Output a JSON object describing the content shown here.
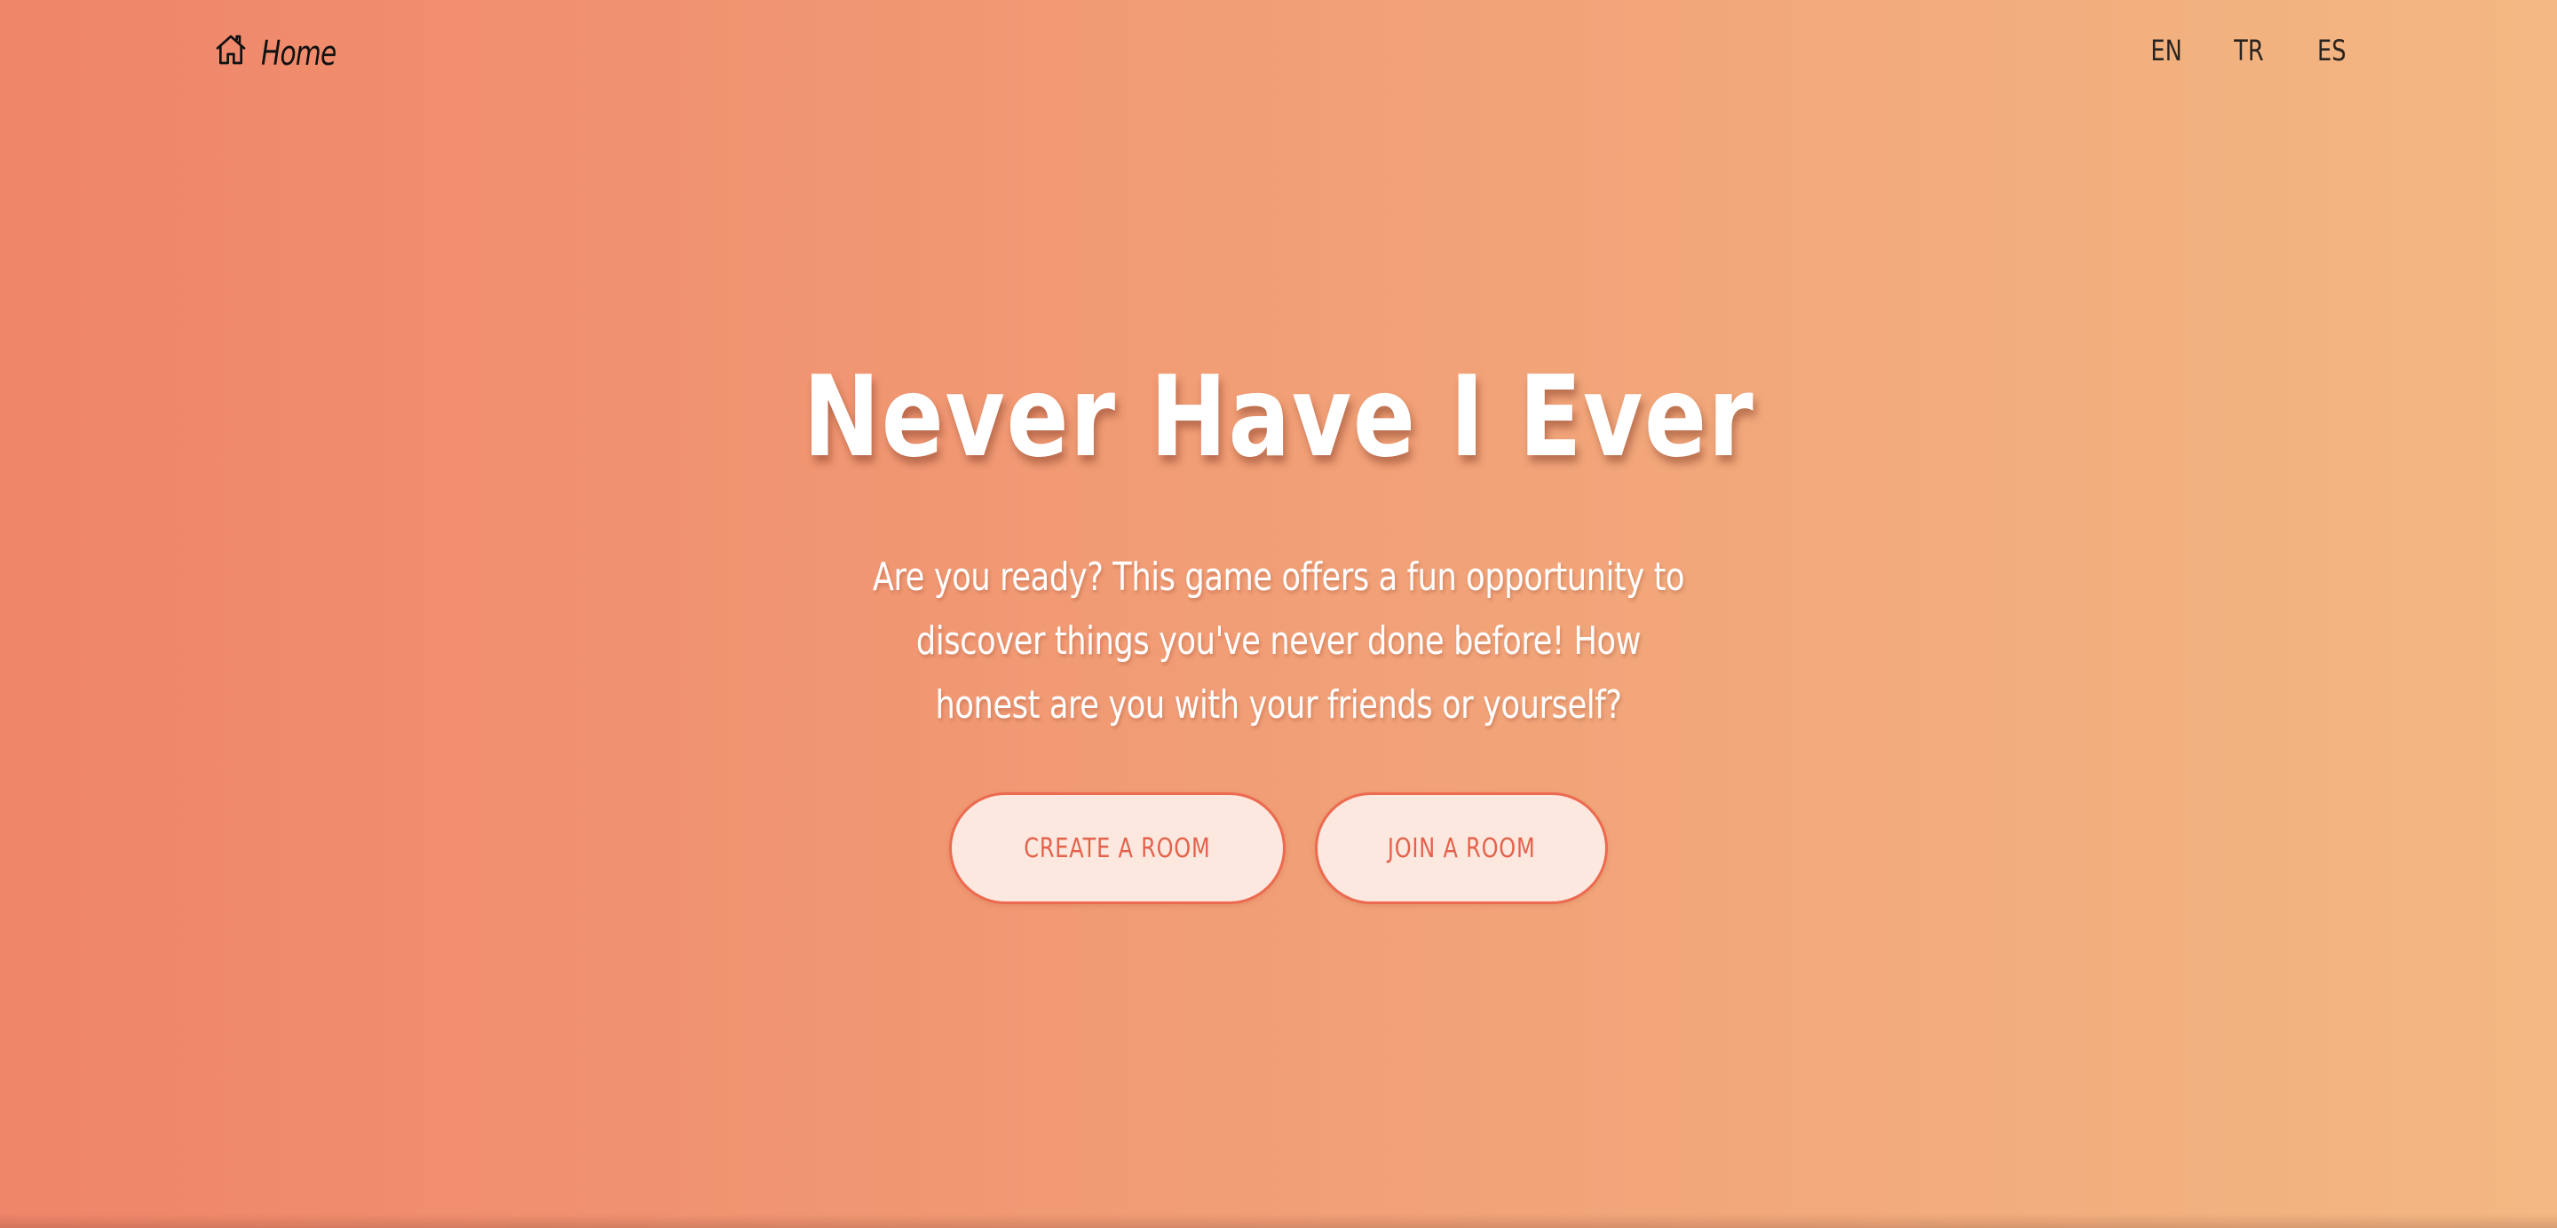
{
  "nav": {
    "home_label": "Home",
    "home_icon": "home-icon",
    "languages": [
      "EN",
      "TR",
      "ES"
    ]
  },
  "hero": {
    "title": "Never Have I Ever",
    "description": "Are you ready? This game offers a fun opportunity to discover things you've never done before! How honest are you with your friends or yourself?"
  },
  "actions": {
    "create_label": "CREATE A ROOM",
    "join_label": "JOIN A ROOM"
  },
  "colors": {
    "gradient_start": "#ef8569",
    "gradient_end": "#f3b883",
    "button_bg": "#fce8df",
    "button_accent": "#e4624b"
  }
}
